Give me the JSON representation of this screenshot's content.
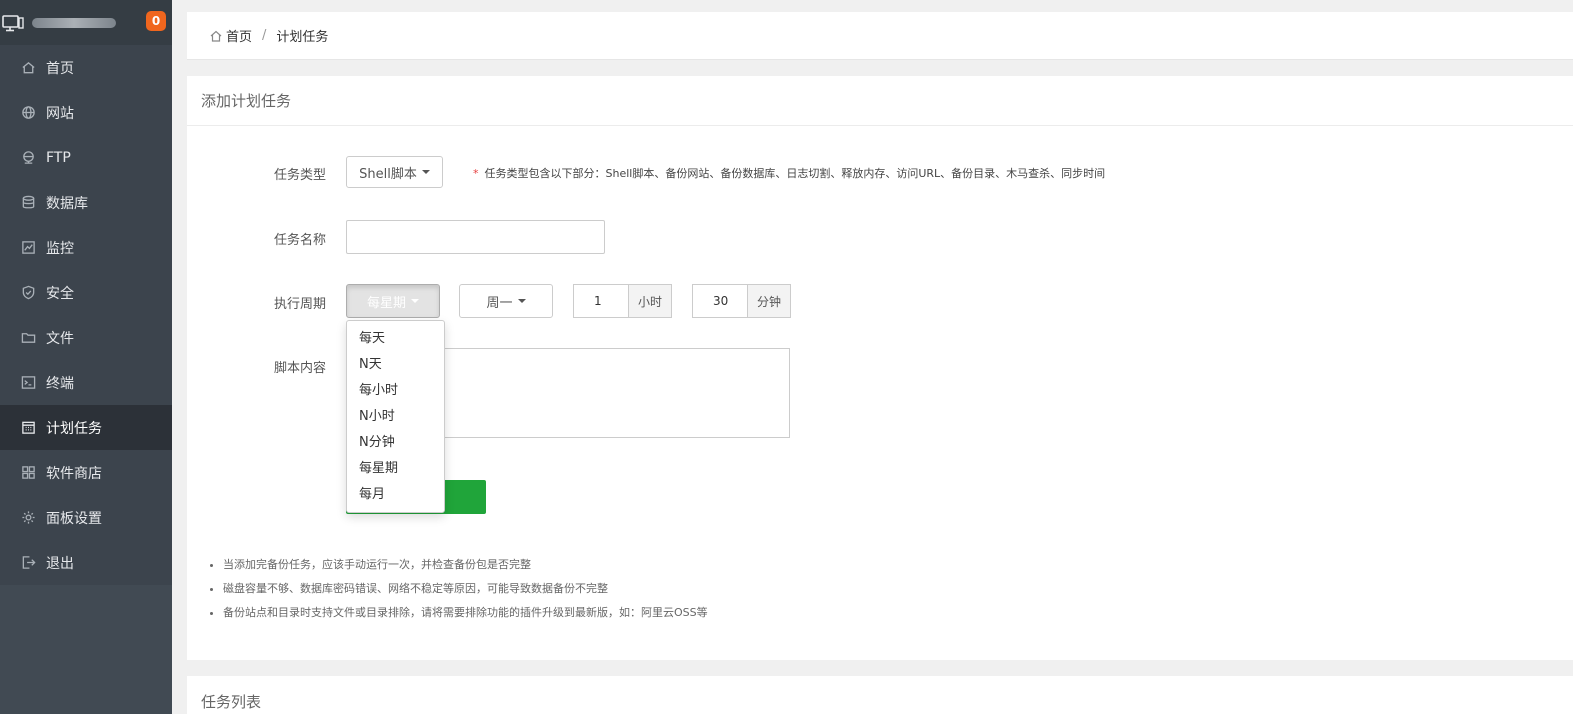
{
  "header": {
    "site_title": "",
    "badge_count": "0"
  },
  "sidebar": {
    "items": [
      {
        "label": "首页",
        "icon": "home-icon"
      },
      {
        "label": "网站",
        "icon": "globe-icon"
      },
      {
        "label": "FTP",
        "icon": "ftp-icon"
      },
      {
        "label": "数据库",
        "icon": "database-icon"
      },
      {
        "label": "监控",
        "icon": "monitor-chart-icon"
      },
      {
        "label": "安全",
        "icon": "shield-icon"
      },
      {
        "label": "文件",
        "icon": "folder-icon"
      },
      {
        "label": "终端",
        "icon": "terminal-icon"
      },
      {
        "label": "计划任务",
        "icon": "calendar-icon",
        "active": true
      },
      {
        "label": "软件商店",
        "icon": "grid-icon"
      },
      {
        "label": "面板设置",
        "icon": "gear-icon"
      },
      {
        "label": "退出",
        "icon": "logout-icon"
      }
    ]
  },
  "breadcrumb": {
    "home": "首页",
    "separator": "/",
    "current": "计划任务"
  },
  "form": {
    "title": "添加计划任务",
    "task_type_label": "任务类型",
    "task_type_value": "Shell脚本",
    "task_type_hint_star": "*",
    "task_type_hint": "任务类型包含以下部分：Shell脚本、备份网站、备份数据库、日志切割、释放内存、访问URL、备份目录、木马查杀、同步时间",
    "task_name_label": "任务名称",
    "task_name_value": "",
    "cycle_label": "执行周期",
    "cycle_value": "每星期",
    "weekday_value": "周一",
    "hour_value": "1",
    "hour_unit": "小时",
    "minute_value": "30",
    "minute_unit": "分钟",
    "script_label": "脚本内容",
    "script_value": "",
    "cycle_options": [
      "每天",
      "N天",
      "每小时",
      "N小时",
      "N分钟",
      "每星期",
      "每月"
    ]
  },
  "notes": [
    "当添加完备份任务，应该手动运行一次，并检查备份包是否完整",
    "磁盘容量不够、数据库密码错误、网络不稳定等原因，可能导致数据备份不完整",
    "备份站点和目录时支持文件或目录排除，请将需要排除功能的插件升级到最新版，如：阿里云OSS等"
  ],
  "task_list": {
    "title": "任务列表"
  },
  "colors": {
    "sidebar_bg": "#3c444d",
    "sidebar_active": "#2c3138",
    "accent_green": "#20a53a",
    "badge_orange": "#f0661e"
  }
}
